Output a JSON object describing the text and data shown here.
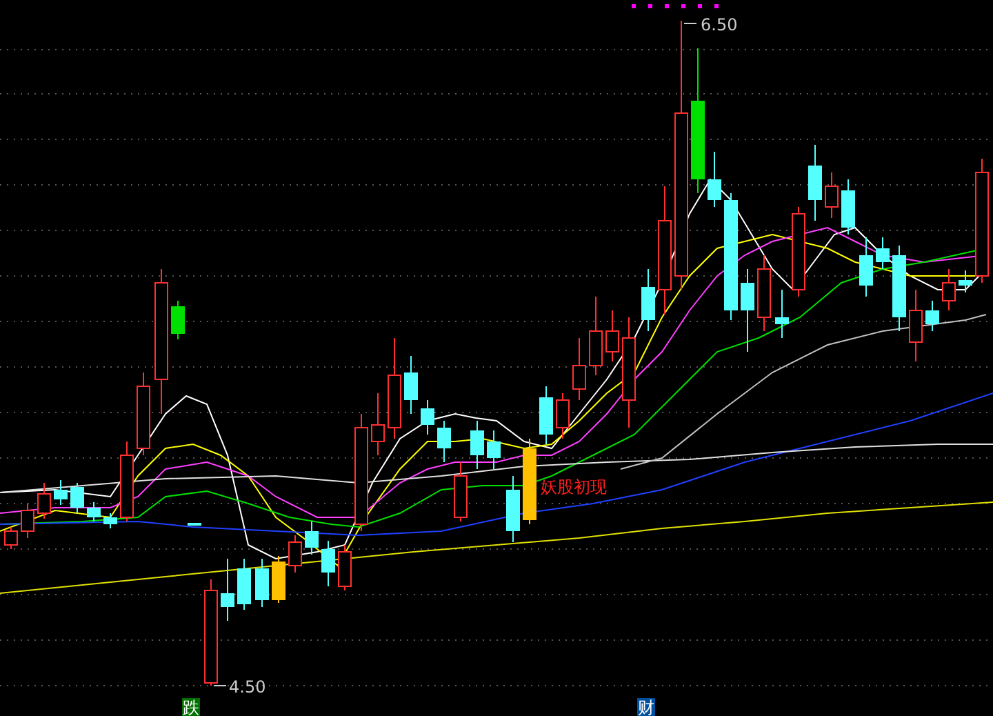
{
  "chart": {
    "peak_label": "6.50",
    "trough_label": "4.50",
    "signal_label": "妖股初现"
  },
  "bottom_markers": [
    {
      "text": "跌",
      "kind": "fall"
    },
    {
      "text": "财",
      "kind": "wealth"
    }
  ]
}
